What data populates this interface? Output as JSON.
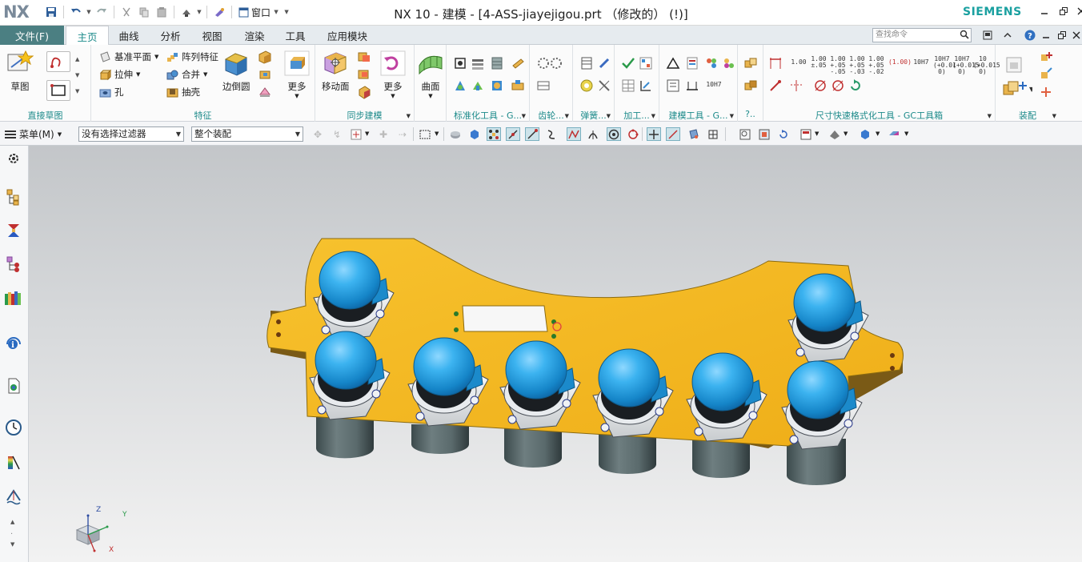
{
  "app": {
    "logo": "NX",
    "title": "NX 10 - 建模 - [4-ASS-jiayejigou.prt （修改的） (!)]",
    "brand": "SIEMENS",
    "window_menu": "窗口"
  },
  "tabs": {
    "file": "文件(F)",
    "items": [
      "主页",
      "曲线",
      "分析",
      "视图",
      "渲染",
      "工具",
      "应用模块"
    ],
    "active": "主页",
    "search_placeholder": "查找命令"
  },
  "ribbon": {
    "sketch_group": {
      "label": "直接草图",
      "sketch_button": "草图"
    },
    "feature_group": {
      "label": "特征",
      "datum_plane": "基准平面",
      "extrude": "拉伸",
      "hole": "孔",
      "pattern_feature": "阵列特征",
      "unite": "合并",
      "shell": "抽壳",
      "edge_blend": "边倒圆",
      "more": "更多"
    },
    "sync_group": {
      "label": "同步建模",
      "move_face": "移动面",
      "more": "更多"
    },
    "surface_group": {
      "label": "曲面",
      "surface": "曲面"
    },
    "std_group": {
      "label": "标准化工具 - G..."
    },
    "gear_group": {
      "label": "齿轮..."
    },
    "spring_group": {
      "label": "弹簧..."
    },
    "machining_group": {
      "label": "加工..."
    },
    "modeling_tools_group": {
      "label": "建模工具 - G..."
    },
    "misc_group": {
      "label": "?.."
    },
    "dim_group": {
      "label": "尺寸快速格式化工具 - GC工具箱",
      "items": [
        "1.00",
        "1.00 ±.05",
        "1.00 +.05 -.05",
        "1.00 +.05 -.03",
        "1.00 +.05 -.02",
        "(1.00)",
        "10H7",
        "10H7 (+0.01 0)",
        "10H7 (+0.015 0)",
        "10 (+0.015 0)"
      ],
      "ref_label": "10H7"
    },
    "assembly_group": {
      "label": "装配"
    }
  },
  "selection_bar": {
    "menu": "菜单(M)",
    "filter": "没有选择过滤器",
    "scope": "整个装配"
  },
  "triad": {
    "z": "Z",
    "y": "Y",
    "x": "X"
  },
  "colors": {
    "accent": "#1c8a8a",
    "file_tab": "#4b7f82",
    "plate": "#f3b722",
    "cap": "#2aa3e3",
    "cylinder": "#5a6a6a"
  }
}
